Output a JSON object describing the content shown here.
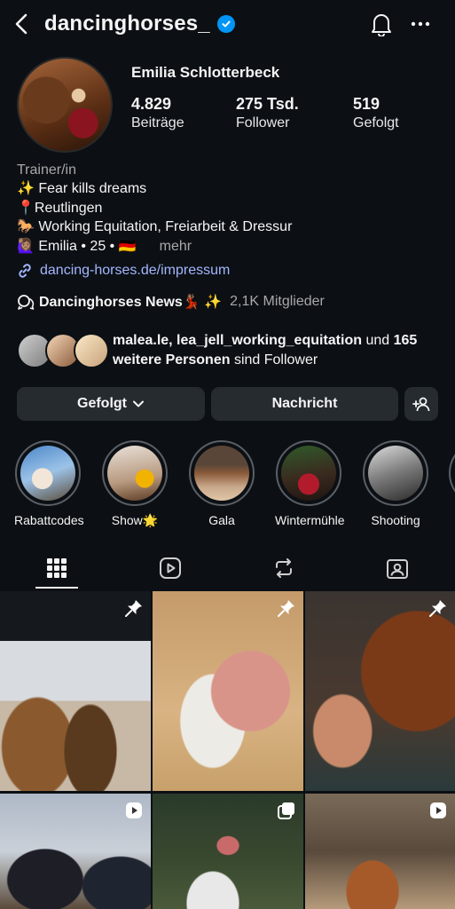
{
  "header": {
    "username": "dancinghorses_",
    "icons": [
      "back-arrow-icon",
      "verified-badge-icon",
      "bell-icon",
      "more-icon"
    ]
  },
  "profile": {
    "display_name": "Emilia Schlotterbeck",
    "stats": [
      {
        "value": "4.829",
        "label": "Beiträge"
      },
      {
        "value": "275 Tsd.",
        "label": "Follower"
      },
      {
        "value": "519",
        "label": "Gefolgt"
      }
    ],
    "category": "Trainer/in",
    "bio_lines": [
      "✨ Fear kills dreams",
      "📍Reutlingen",
      "🐎 Working Equitation, Freiarbeit & Dressur",
      "🙋🏽‍♀️ Emilia • 25 • 🇩🇪"
    ],
    "more_label": "mehr",
    "link": "dancing-horses.de/impressum"
  },
  "channel": {
    "name": "Dancinghorses News💃🏽 ✨",
    "members": "2,1K Mitglieder"
  },
  "mutual": {
    "names": "malea.le, lea_jell_working_equitation",
    "und": "und",
    "count": "165 weitere Personen",
    "suffix": "sind Follower"
  },
  "buttons": {
    "followed": "Gefolgt",
    "message": "Nachricht"
  },
  "highlights": [
    {
      "label": "Rabattcodes"
    },
    {
      "label": "Show🌟"
    },
    {
      "label": "Gala"
    },
    {
      "label": "Wintermühle"
    },
    {
      "label": "Shooting"
    }
  ],
  "tabs": [
    "grid",
    "reels",
    "reposts",
    "tagged"
  ],
  "colors": {
    "background": "#0c1014",
    "button_bg": "#262b30",
    "link": "#a3b6ff",
    "verified": "#0095f6",
    "muted": "#a8a8a8"
  }
}
